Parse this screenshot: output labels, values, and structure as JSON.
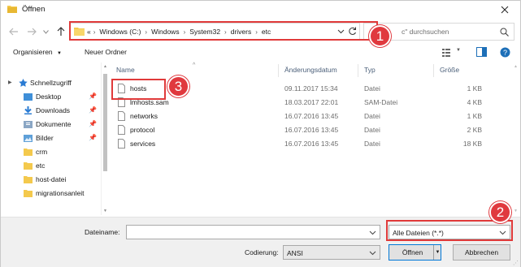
{
  "window": {
    "title": "Öffnen"
  },
  "address": {
    "crumbs": [
      "«",
      "Windows (C:)",
      "Windows",
      "System32",
      "drivers",
      "etc"
    ]
  },
  "search": {
    "placeholder": "\"etc\" durchsuchen",
    "visible_text": "c\" durchsuchen"
  },
  "toolbar": {
    "organize_label": "Organisieren",
    "new_folder_label": "Neuer Ordner"
  },
  "sidebar": {
    "items": [
      {
        "label": "Schnellzugriff",
        "icon": "star-icon",
        "pinned": false
      },
      {
        "label": "Desktop",
        "icon": "desktop-folder-icon",
        "pinned": true
      },
      {
        "label": "Downloads",
        "icon": "download-arrow-icon",
        "pinned": true
      },
      {
        "label": "Dokumente",
        "icon": "documents-folder-icon",
        "pinned": true
      },
      {
        "label": "Bilder",
        "icon": "pictures-folder-icon",
        "pinned": true
      },
      {
        "label": "crm",
        "icon": "folder-icon",
        "pinned": false
      },
      {
        "label": "etc",
        "icon": "folder-icon",
        "pinned": false
      },
      {
        "label": "host-datei",
        "icon": "folder-icon",
        "pinned": false
      },
      {
        "label": "migrationsanleit",
        "icon": "folder-icon",
        "pinned": false
      }
    ]
  },
  "list": {
    "columns": {
      "name": "Name",
      "date": "Änderungsdatum",
      "type": "Typ",
      "size": "Größe"
    },
    "rows": [
      {
        "name": "hosts",
        "date": "09.11.2017 15:34",
        "type": "Datei",
        "size": "1 KB"
      },
      {
        "name": "lmhosts.sam",
        "date": "18.03.2017 22:01",
        "type": "SAM-Datei",
        "size": "4 KB"
      },
      {
        "name": "networks",
        "date": "16.07.2016 13:45",
        "type": "Datei",
        "size": "1 KB"
      },
      {
        "name": "protocol",
        "date": "16.07.2016 13:45",
        "type": "Datei",
        "size": "2 KB"
      },
      {
        "name": "services",
        "date": "16.07.2016 13:45",
        "type": "Datei",
        "size": "18 KB"
      }
    ]
  },
  "bottom": {
    "filename_label": "Dateiname:",
    "filename_value": "",
    "filetype_value": "Alle Dateien  (*.*)",
    "encoding_label": "Codierung:",
    "encoding_value": "ANSI",
    "open_label": "Öffnen",
    "cancel_label": "Abbrechen"
  },
  "annotations": {
    "marker1": "1",
    "marker2": "2",
    "marker3": "3"
  },
  "colors": {
    "accent": "#0078d7",
    "annotation_red": "#e0393e",
    "folder_yellow": "#f4c94d"
  }
}
